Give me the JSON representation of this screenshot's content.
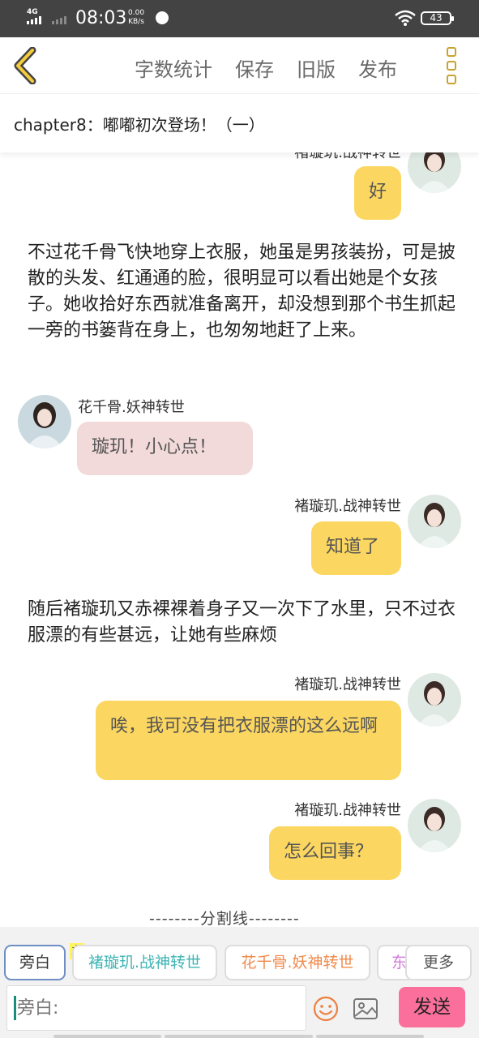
{
  "status_bar": {
    "network": "4G",
    "time": "08:03",
    "speed_value": "0.00",
    "speed_unit": "KB/s",
    "battery": "43"
  },
  "toolbar": {
    "word_count": "字数统计",
    "save": "保存",
    "old_version": "旧版",
    "publish": "发布"
  },
  "chapter": {
    "title": "chapter8：嘟嘟初次登场！（一）"
  },
  "feed": {
    "top_partial_name": "褚璇玑.战神转世",
    "m1_text": "好",
    "narration1": "不过花千骨飞快地穿上衣服，她虽是男孩装扮，可是披散的头发、红通通的脸，很明显可以看出她是个女孩子。她收拾好东西就准备离开，却没想到那个书生抓起一旁的书篓背在身上，也匆匆地赶了上来。",
    "m2_name": "花千骨.妖神转世",
    "m2_text": "璇玑！小心点！",
    "m3_name": "褚璇玑.战神转世",
    "m3_text": "知道了",
    "narration2": "随后褚璇玑又赤裸裸着身子又一次下了水里，只不过衣服漂的有些甚远，让她有些麻烦",
    "m4_name": "褚璇玑.战神转世",
    "m4_text": "唉，我可没有把衣服漂的这么远啊",
    "m5_name": "褚璇玑.战神转世",
    "m5_text": "怎么回事？",
    "divider": "--------分割线--------"
  },
  "characters": {
    "narration": "旁白",
    "host_badge": "主",
    "char1": "褚璇玑.战神转世",
    "char2": "花千骨.妖神转世",
    "char3_partial": "东",
    "more": "更多"
  },
  "input": {
    "placeholder": "旁白:",
    "send": "发送"
  },
  "colors": {
    "yellow_bubble": "#fbd660",
    "pink_bubble": "#f3dada",
    "char1_color": "#3fb4b4",
    "char2_color": "#f08a4b",
    "char3_color": "#d27ad9",
    "send_button": "#fb6f9c",
    "back_icon": "#c7a32f"
  }
}
